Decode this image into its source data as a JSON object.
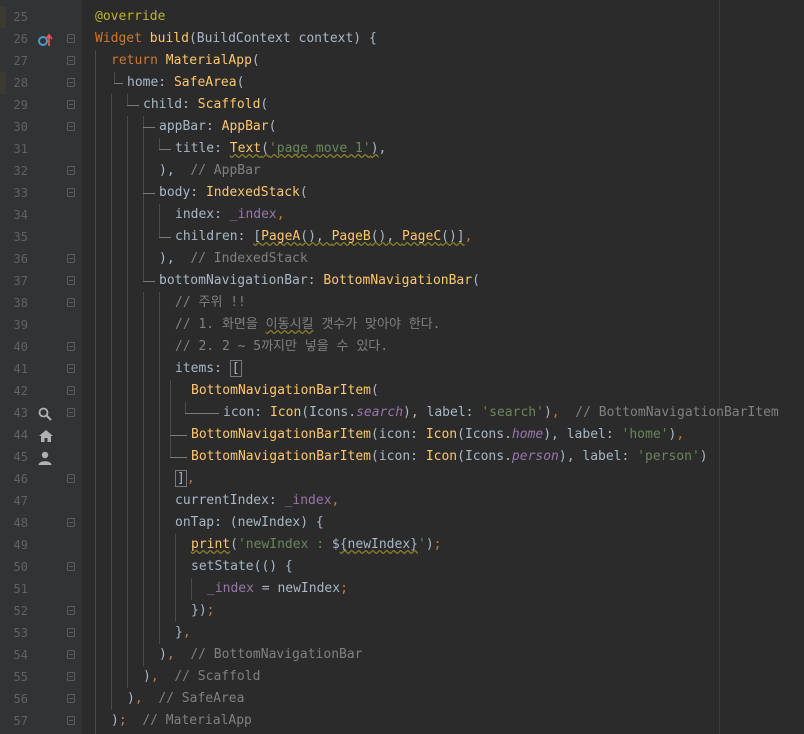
{
  "editor": {
    "accent_colors": {
      "keyword": "#cc7832",
      "function": "#ffc66d",
      "string": "#6a8759",
      "comment": "#808080",
      "field": "#9876aa",
      "annotation": "#bbb529"
    },
    "lines": [
      {
        "n": "25",
        "code": "@override"
      },
      {
        "n": "26",
        "code": "Widget build(BuildContext context) {",
        "icon": "override-arrow-icon"
      },
      {
        "n": "27",
        "code": "return MaterialApp("
      },
      {
        "n": "28",
        "code": "home: SafeArea("
      },
      {
        "n": "29",
        "code": "child: Scaffold("
      },
      {
        "n": "30",
        "code": "appBar: AppBar("
      },
      {
        "n": "31",
        "code": "title: Text('page move 1'),"
      },
      {
        "n": "32",
        "code": "),  // AppBar"
      },
      {
        "n": "33",
        "code": "body: IndexedStack("
      },
      {
        "n": "34",
        "code": "index: _index,"
      },
      {
        "n": "35",
        "code": "children: [PageA(), PageB(), PageC()],"
      },
      {
        "n": "36",
        "code": "),  // IndexedStack"
      },
      {
        "n": "37",
        "code": "bottomNavigationBar: BottomNavigationBar("
      },
      {
        "n": "38",
        "code": "// 주위 !!"
      },
      {
        "n": "39",
        "code": "// 1. 화면을 이동시킬 갯수가 맞아야 한다."
      },
      {
        "n": "40",
        "code": "// 2. 2 ~ 5까지만 넣을 수 있다."
      },
      {
        "n": "41",
        "code": "items: ["
      },
      {
        "n": "42",
        "code": "BottomNavigationBarItem("
      },
      {
        "n": "43",
        "code": "icon: Icon(Icons.search), label: 'search'),  // BottomNavigationBarItem",
        "icon": "search-icon"
      },
      {
        "n": "44",
        "code": "BottomNavigationBarItem(icon: Icon(Icons.home), label: 'home'),",
        "icon": "home-icon"
      },
      {
        "n": "45",
        "code": "BottomNavigationBarItem(icon: Icon(Icons.person), label: 'person')",
        "icon": "person-icon"
      },
      {
        "n": "46",
        "code": "],"
      },
      {
        "n": "47",
        "code": "currentIndex: _index,"
      },
      {
        "n": "48",
        "code": "onTap: (newIndex) {"
      },
      {
        "n": "49",
        "code": "print('newIndex : ${newIndex}');"
      },
      {
        "n": "50",
        "code": "setState(() {"
      },
      {
        "n": "51",
        "code": "_index = newIndex;"
      },
      {
        "n": "52",
        "code": "});"
      },
      {
        "n": "53",
        "code": "},"
      },
      {
        "n": "54",
        "code": "),  // BottomNavigationBar"
      },
      {
        "n": "55",
        "code": "),  // Scaffold"
      },
      {
        "n": "56",
        "code": "),  // SafeArea"
      },
      {
        "n": "57",
        "code": ");  // MaterialApp"
      }
    ]
  }
}
